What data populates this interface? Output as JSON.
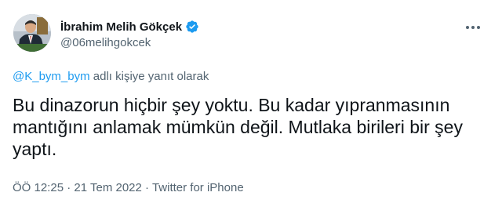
{
  "author": {
    "display_name": "İbrahim Melih Gökçek",
    "handle": "@06melihgokcek",
    "verified_color": "#1d9bf0"
  },
  "reply_context": {
    "mention": "@K_bym_bym",
    "suffix": "adlı kişiye yanıt olarak"
  },
  "tweet": {
    "text": "Bu dinazorun hiçbir şey yoktu. Bu kadar yıpranmasının mantığını anlamak mümkün değil. Mutlaka birileri bir şey yaptı."
  },
  "meta": {
    "time": "ÖÖ 12:25",
    "separator1": "·",
    "date": "21 Tem 2022",
    "separator2": "·",
    "source": "Twitter for iPhone"
  },
  "icons": {
    "verified": "verified-badge-icon",
    "more": "more-options-icon"
  }
}
